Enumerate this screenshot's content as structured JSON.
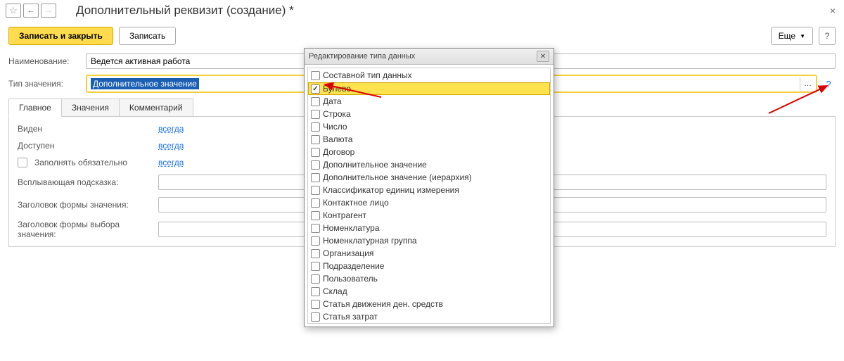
{
  "header": {
    "title": "Дополнительный реквизит (создание) *"
  },
  "toolbar": {
    "save_close_label": "Записать и закрыть",
    "save_label": "Записать",
    "more_label": "Еще",
    "help_label": "?"
  },
  "form": {
    "name_label": "Наименование:",
    "name_value": "Ведется активная работа",
    "type_label": "Тип значения:",
    "type_value": "Дополнительное значение"
  },
  "tabs": {
    "main": "Главное",
    "values": "Значения",
    "comment": "Комментарий"
  },
  "props": {
    "visible_label": "Виден",
    "visible_link": "всегда",
    "available_label": "Доступен",
    "available_link": "всегда",
    "fill_required_label": "Заполнять обязательно",
    "fill_required_link": "всегда",
    "tooltip_label": "Всплывающая подсказка:",
    "tooltip_value": "",
    "value_form_title_label": "Заголовок формы значения:",
    "value_form_title_value": "",
    "value_choice_form_title_label": "Заголовок формы выбора значения:",
    "value_choice_form_title_value": ""
  },
  "dialog": {
    "title": "Редактирование типа данных",
    "composite_label": "Составной тип данных",
    "types": [
      {
        "label": "Булево",
        "checked": true,
        "selected": true
      },
      {
        "label": "Дата",
        "checked": false,
        "selected": false
      },
      {
        "label": "Строка",
        "checked": false,
        "selected": false
      },
      {
        "label": "Число",
        "checked": false,
        "selected": false
      },
      {
        "label": "Валюта",
        "checked": false,
        "selected": false
      },
      {
        "label": "Договор",
        "checked": false,
        "selected": false
      },
      {
        "label": "Дополнительное значение",
        "checked": false,
        "selected": false
      },
      {
        "label": "Дополнительное значение (иерархия)",
        "checked": false,
        "selected": false
      },
      {
        "label": "Классификатор единиц измерения",
        "checked": false,
        "selected": false
      },
      {
        "label": "Контактное лицо",
        "checked": false,
        "selected": false
      },
      {
        "label": "Контрагент",
        "checked": false,
        "selected": false
      },
      {
        "label": "Номенклатура",
        "checked": false,
        "selected": false
      },
      {
        "label": "Номенклатурная группа",
        "checked": false,
        "selected": false
      },
      {
        "label": "Организация",
        "checked": false,
        "selected": false
      },
      {
        "label": "Подразделение",
        "checked": false,
        "selected": false
      },
      {
        "label": "Пользователь",
        "checked": false,
        "selected": false
      },
      {
        "label": "Склад",
        "checked": false,
        "selected": false
      },
      {
        "label": "Статья движения ден. средств",
        "checked": false,
        "selected": false
      },
      {
        "label": "Статья затрат",
        "checked": false,
        "selected": false
      }
    ]
  }
}
